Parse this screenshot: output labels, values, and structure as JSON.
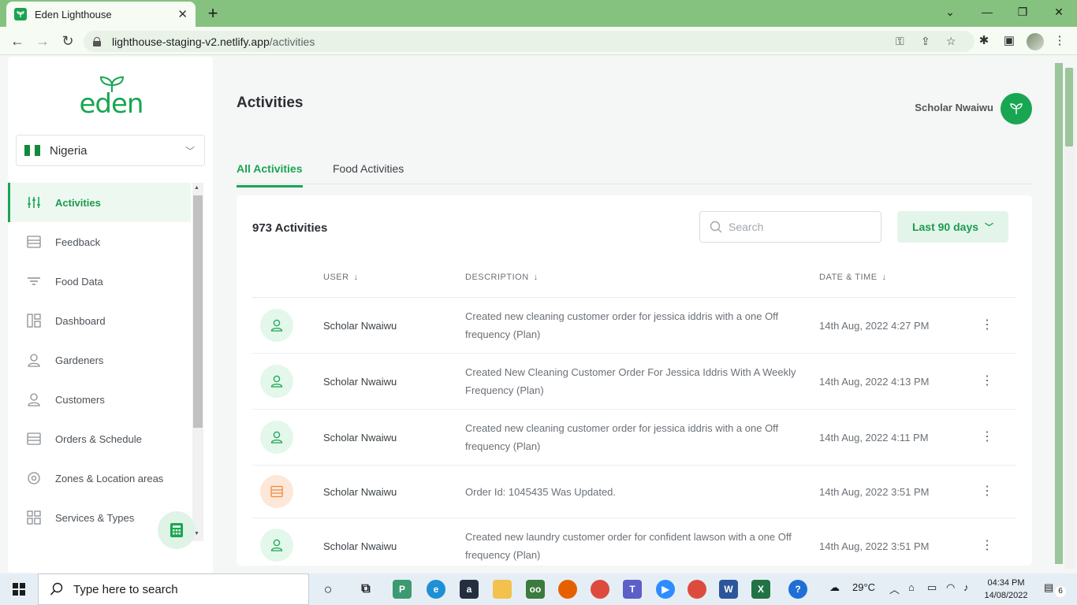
{
  "browser": {
    "tab_title": "Eden Lighthouse",
    "url_domain": "lighthouse-staging-v2.netlify.app",
    "url_path": "/activities"
  },
  "sidebar": {
    "logo_text": "eden",
    "country": "Nigeria",
    "items": [
      {
        "label": "Activities",
        "icon": "sliders-icon",
        "active": true
      },
      {
        "label": "Feedback",
        "icon": "list-icon"
      },
      {
        "label": "Food Data",
        "icon": "filter-icon"
      },
      {
        "label": "Dashboard",
        "icon": "grid-icon"
      },
      {
        "label": "Gardeners",
        "icon": "person-icon"
      },
      {
        "label": "Customers",
        "icon": "person-icon"
      },
      {
        "label": "Orders & Schedule",
        "icon": "list-icon"
      },
      {
        "label": "Zones & Location areas",
        "icon": "location-icon"
      },
      {
        "label": "Services & Types",
        "icon": "grid-icon"
      }
    ]
  },
  "header": {
    "title": "Activities",
    "user_name": "Scholar Nwaiwu"
  },
  "tabs": [
    {
      "label": "All Activities",
      "active": true
    },
    {
      "label": "Food Activities",
      "active": false
    }
  ],
  "card": {
    "count_label": "973 Activities",
    "search_placeholder": "Search",
    "range_label": "Last 90 days",
    "columns": {
      "user": "USER",
      "description": "DESCRIPTION",
      "date": "DATE & TIME"
    },
    "rows": [
      {
        "user": "Scholar Nwaiwu",
        "description": "Created new cleaning customer order for jessica iddris with a one Off frequency (Plan)",
        "date": "14th Aug, 2022 4:27 PM",
        "avatar": "person"
      },
      {
        "user": "Scholar Nwaiwu",
        "description": "Created New Cleaning Customer Order For Jessica Iddris With A Weekly Frequency (Plan)",
        "date": "14th Aug, 2022 4:13 PM",
        "avatar": "person"
      },
      {
        "user": "Scholar Nwaiwu",
        "description": "Created new cleaning customer order for jessica iddris with a one Off frequency (Plan)",
        "date": "14th Aug, 2022 4:11 PM",
        "avatar": "person"
      },
      {
        "user": "Scholar Nwaiwu",
        "description": "Order Id: 1045435 Was Updated.",
        "date": "14th Aug, 2022 3:51 PM",
        "avatar": "order"
      },
      {
        "user": "Scholar Nwaiwu",
        "description": "Created new laundry customer order for confident lawson with a one Off frequency (Plan)",
        "date": "14th Aug, 2022 3:51 PM",
        "avatar": "person"
      }
    ]
  },
  "taskbar": {
    "search_text": "Type here to search",
    "weather": "29°C",
    "time": "04:34 PM",
    "date": "14/08/2022",
    "notifications": "6"
  },
  "colors": {
    "brand": "#19a652",
    "browser_frame": "#85c17f"
  }
}
